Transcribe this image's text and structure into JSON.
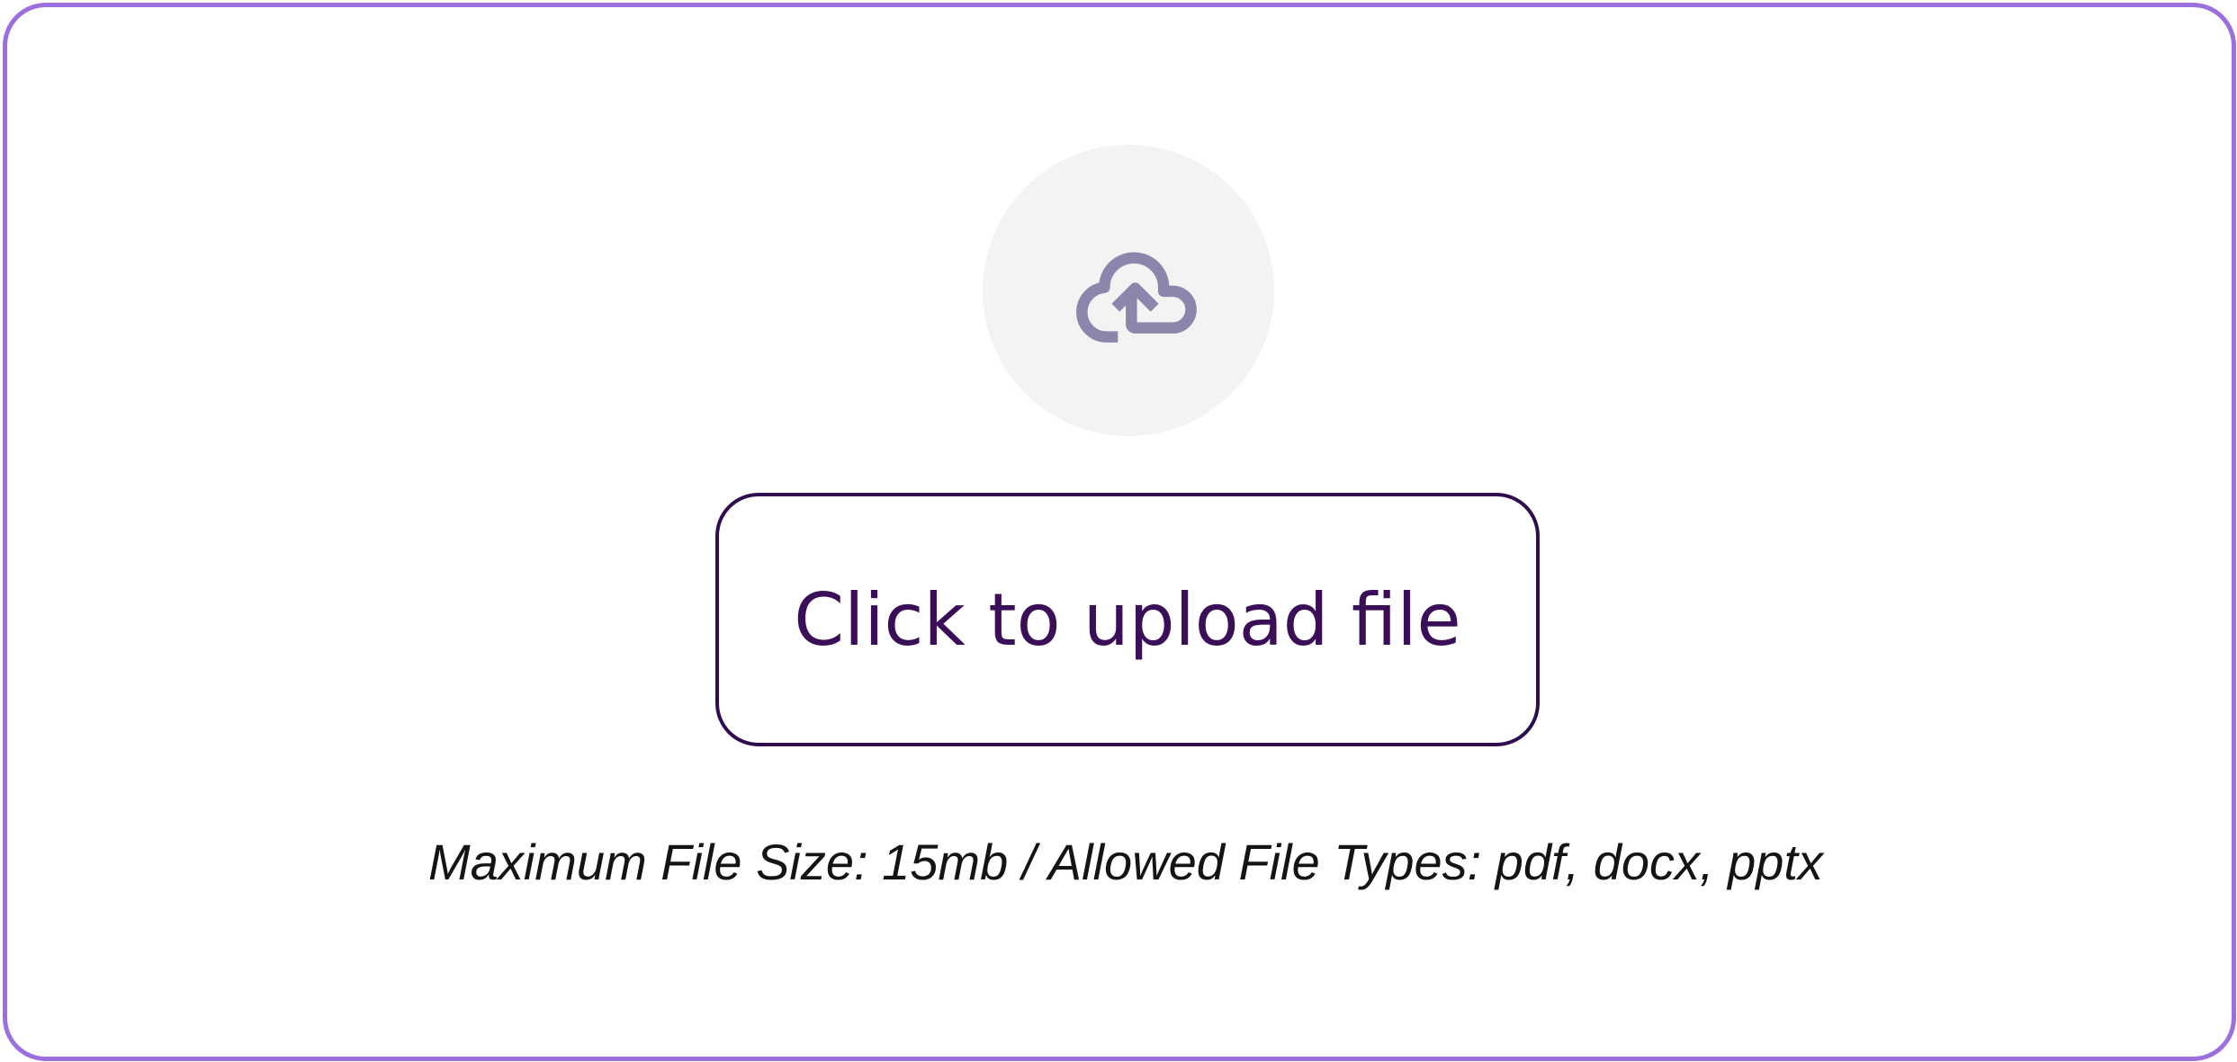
{
  "upload": {
    "icon": "cloud-upload-icon",
    "button_label": "Click to upload file",
    "hint": "Maximum File Size: 15mb / Allowed File Types: pdf, docx, pptx"
  },
  "colors": {
    "border": "#9b6fdd",
    "button_border": "#2e0e4f",
    "button_text": "#3a0f57",
    "icon": "#8c86ad",
    "icon_bg": "#f3f3f3"
  }
}
